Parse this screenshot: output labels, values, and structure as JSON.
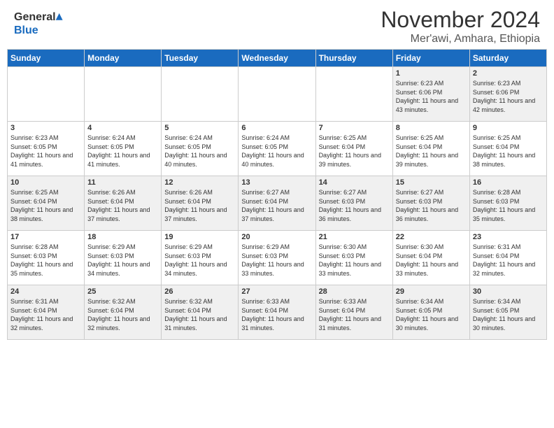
{
  "header": {
    "logo_general": "General",
    "logo_blue": "Blue",
    "title": "November 2024",
    "subtitle": "Mer'awi, Amhara, Ethiopia"
  },
  "weekdays": [
    "Sunday",
    "Monday",
    "Tuesday",
    "Wednesday",
    "Thursday",
    "Friday",
    "Saturday"
  ],
  "weeks": [
    [
      {
        "day": "",
        "info": ""
      },
      {
        "day": "",
        "info": ""
      },
      {
        "day": "",
        "info": ""
      },
      {
        "day": "",
        "info": ""
      },
      {
        "day": "",
        "info": ""
      },
      {
        "day": "1",
        "info": "Sunrise: 6:23 AM\nSunset: 6:06 PM\nDaylight: 11 hours and 43 minutes."
      },
      {
        "day": "2",
        "info": "Sunrise: 6:23 AM\nSunset: 6:06 PM\nDaylight: 11 hours and 42 minutes."
      }
    ],
    [
      {
        "day": "3",
        "info": "Sunrise: 6:23 AM\nSunset: 6:05 PM\nDaylight: 11 hours and 41 minutes."
      },
      {
        "day": "4",
        "info": "Sunrise: 6:24 AM\nSunset: 6:05 PM\nDaylight: 11 hours and 41 minutes."
      },
      {
        "day": "5",
        "info": "Sunrise: 6:24 AM\nSunset: 6:05 PM\nDaylight: 11 hours and 40 minutes."
      },
      {
        "day": "6",
        "info": "Sunrise: 6:24 AM\nSunset: 6:05 PM\nDaylight: 11 hours and 40 minutes."
      },
      {
        "day": "7",
        "info": "Sunrise: 6:25 AM\nSunset: 6:04 PM\nDaylight: 11 hours and 39 minutes."
      },
      {
        "day": "8",
        "info": "Sunrise: 6:25 AM\nSunset: 6:04 PM\nDaylight: 11 hours and 39 minutes."
      },
      {
        "day": "9",
        "info": "Sunrise: 6:25 AM\nSunset: 6:04 PM\nDaylight: 11 hours and 38 minutes."
      }
    ],
    [
      {
        "day": "10",
        "info": "Sunrise: 6:25 AM\nSunset: 6:04 PM\nDaylight: 11 hours and 38 minutes."
      },
      {
        "day": "11",
        "info": "Sunrise: 6:26 AM\nSunset: 6:04 PM\nDaylight: 11 hours and 37 minutes."
      },
      {
        "day": "12",
        "info": "Sunrise: 6:26 AM\nSunset: 6:04 PM\nDaylight: 11 hours and 37 minutes."
      },
      {
        "day": "13",
        "info": "Sunrise: 6:27 AM\nSunset: 6:04 PM\nDaylight: 11 hours and 37 minutes."
      },
      {
        "day": "14",
        "info": "Sunrise: 6:27 AM\nSunset: 6:03 PM\nDaylight: 11 hours and 36 minutes."
      },
      {
        "day": "15",
        "info": "Sunrise: 6:27 AM\nSunset: 6:03 PM\nDaylight: 11 hours and 36 minutes."
      },
      {
        "day": "16",
        "info": "Sunrise: 6:28 AM\nSunset: 6:03 PM\nDaylight: 11 hours and 35 minutes."
      }
    ],
    [
      {
        "day": "17",
        "info": "Sunrise: 6:28 AM\nSunset: 6:03 PM\nDaylight: 11 hours and 35 minutes."
      },
      {
        "day": "18",
        "info": "Sunrise: 6:29 AM\nSunset: 6:03 PM\nDaylight: 11 hours and 34 minutes."
      },
      {
        "day": "19",
        "info": "Sunrise: 6:29 AM\nSunset: 6:03 PM\nDaylight: 11 hours and 34 minutes."
      },
      {
        "day": "20",
        "info": "Sunrise: 6:29 AM\nSunset: 6:03 PM\nDaylight: 11 hours and 33 minutes."
      },
      {
        "day": "21",
        "info": "Sunrise: 6:30 AM\nSunset: 6:03 PM\nDaylight: 11 hours and 33 minutes."
      },
      {
        "day": "22",
        "info": "Sunrise: 6:30 AM\nSunset: 6:04 PM\nDaylight: 11 hours and 33 minutes."
      },
      {
        "day": "23",
        "info": "Sunrise: 6:31 AM\nSunset: 6:04 PM\nDaylight: 11 hours and 32 minutes."
      }
    ],
    [
      {
        "day": "24",
        "info": "Sunrise: 6:31 AM\nSunset: 6:04 PM\nDaylight: 11 hours and 32 minutes."
      },
      {
        "day": "25",
        "info": "Sunrise: 6:32 AM\nSunset: 6:04 PM\nDaylight: 11 hours and 32 minutes."
      },
      {
        "day": "26",
        "info": "Sunrise: 6:32 AM\nSunset: 6:04 PM\nDaylight: 11 hours and 31 minutes."
      },
      {
        "day": "27",
        "info": "Sunrise: 6:33 AM\nSunset: 6:04 PM\nDaylight: 11 hours and 31 minutes."
      },
      {
        "day": "28",
        "info": "Sunrise: 6:33 AM\nSunset: 6:04 PM\nDaylight: 11 hours and 31 minutes."
      },
      {
        "day": "29",
        "info": "Sunrise: 6:34 AM\nSunset: 6:05 PM\nDaylight: 11 hours and 30 minutes."
      },
      {
        "day": "30",
        "info": "Sunrise: 6:34 AM\nSunset: 6:05 PM\nDaylight: 11 hours and 30 minutes."
      }
    ]
  ]
}
